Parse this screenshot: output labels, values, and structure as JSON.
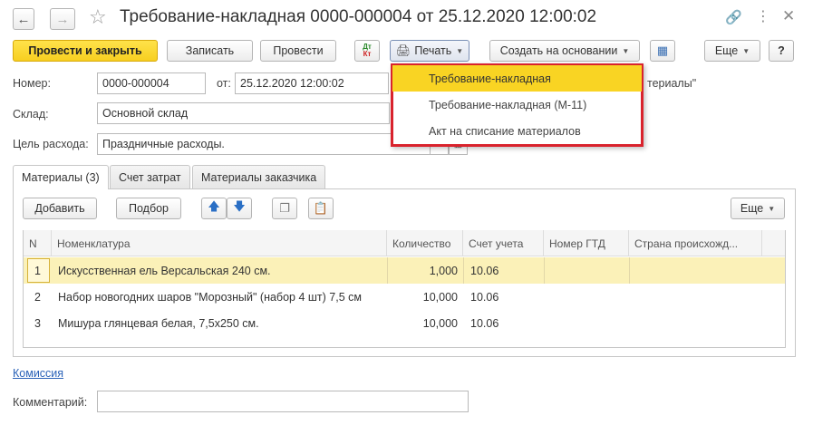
{
  "title": "Требование-накладная 0000-000004 от 25.12.2020 12:00:02",
  "toolbar": {
    "post_close": "Провести и закрыть",
    "save": "Записать",
    "post": "Провести",
    "dt_top": "Дт",
    "dt_bottom": "Кт",
    "print": "Печать",
    "create_based": "Создать на основании",
    "more": "Еще",
    "help": "?"
  },
  "form": {
    "number_label": "Номер:",
    "number_value": "0000-000004",
    "from_label": "от:",
    "date_value": "25.12.2020 12:00:02",
    "date_suffix": "териалы\"",
    "warehouse_label": "Склад:",
    "warehouse_value": "Основной склад",
    "purpose_label": "Цель расхода:",
    "purpose_value": "Праздничные расходы."
  },
  "print_menu": {
    "items": [
      "Требование-накладная",
      "Требование-накладная (М-11)",
      "Акт на списание материалов"
    ]
  },
  "tabs": [
    "Материалы (3)",
    "Счет затрат",
    "Материалы заказчика"
  ],
  "table_toolbar": {
    "add": "Добавить",
    "pick": "Подбор",
    "more": "Еще"
  },
  "table": {
    "columns": [
      "N",
      "Номенклатура",
      "Количество",
      "Счет учета",
      "Номер ГТД",
      "Страна происхожд..."
    ],
    "rows": [
      {
        "n": "1",
        "name": "Искусственная ель Версальская 240 см.",
        "qty": "1,000",
        "account": "10.06"
      },
      {
        "n": "2",
        "name": "Набор новогодних шаров \"Морозный\" (набор 4 шт) 7,5 см",
        "qty": "10,000",
        "account": "10.06"
      },
      {
        "n": "3",
        "name": "Мишура глянцевая белая, 7,5х250 см.",
        "qty": "10,000",
        "account": "10.06"
      }
    ]
  },
  "footer": {
    "commission_link": "Комиссия",
    "comment_label": "Комментарий:",
    "comment_value": ""
  },
  "colors": {
    "primary_button": "#f7cf20",
    "menu_highlight": "#f9d423",
    "menu_border": "#d9232d",
    "selected_row": "#fbf1b8",
    "link": "#2a62b8"
  }
}
